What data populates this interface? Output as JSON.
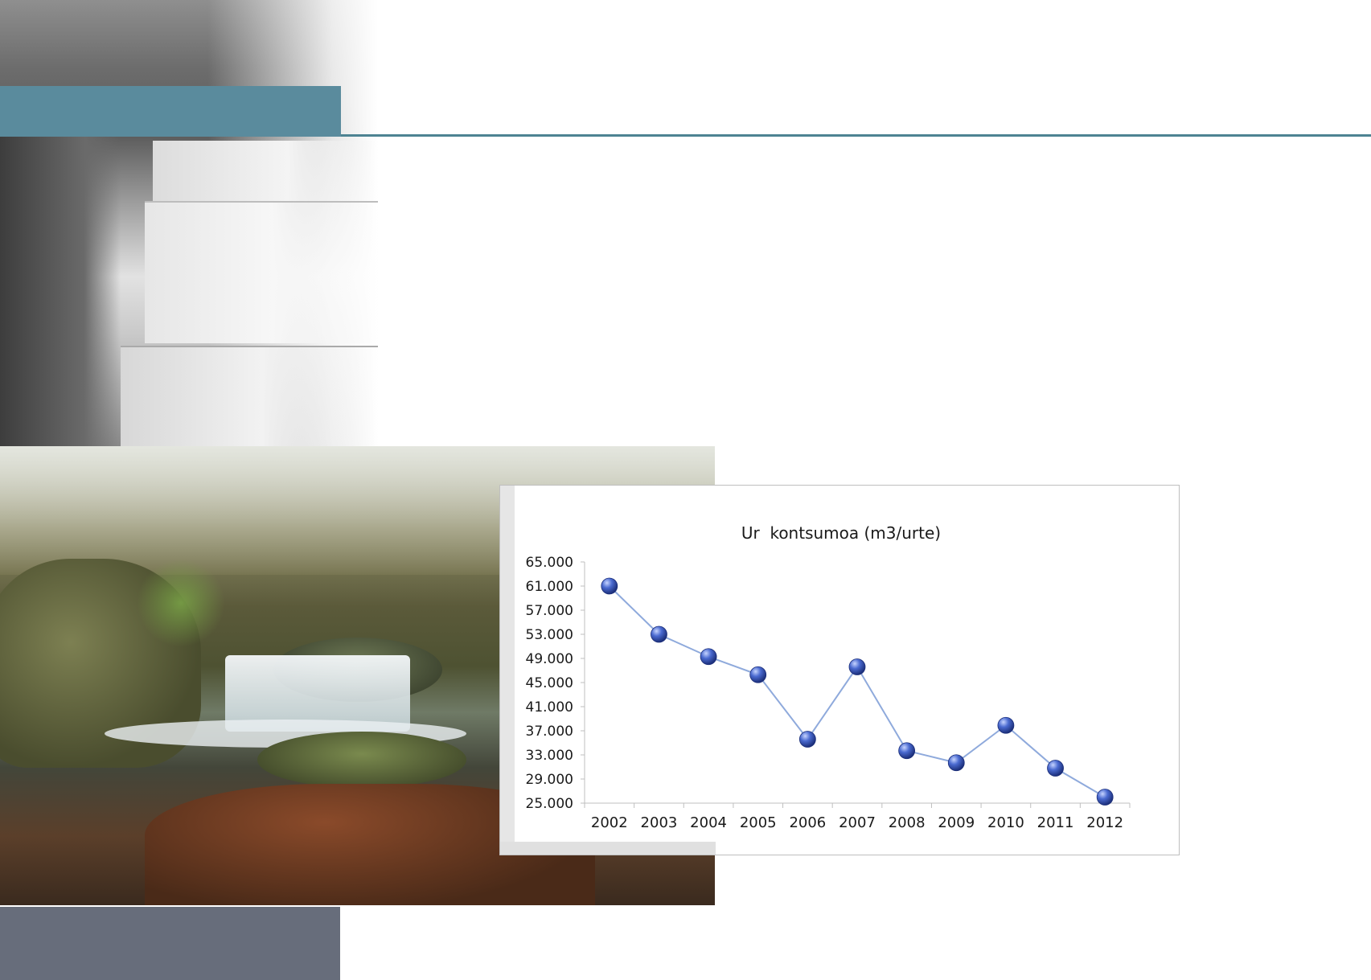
{
  "chart_data": {
    "type": "line",
    "title": "Ur  kontsumoa (m3/urte)",
    "xlabel": "",
    "ylabel": "",
    "categories": [
      "2002",
      "2003",
      "2004",
      "2005",
      "2006",
      "2007",
      "2008",
      "2009",
      "2010",
      "2011",
      "2012"
    ],
    "values": [
      61000,
      53000,
      49300,
      46300,
      35600,
      47600,
      33700,
      31700,
      37900,
      30800,
      26000
    ],
    "ylim": [
      25000,
      65000
    ],
    "yticks": [
      "25.000",
      "29.000",
      "33.000",
      "37.000",
      "41.000",
      "45.000",
      "49.000",
      "53.000",
      "57.000",
      "61.000",
      "65.000"
    ],
    "ytick_values": [
      25000,
      29000,
      33000,
      37000,
      41000,
      45000,
      49000,
      53000,
      57000,
      61000,
      65000
    ],
    "grid": false,
    "legend": "none",
    "line_color": "#8faadc",
    "marker_color": "#2f4fb0"
  },
  "colors": {
    "teal_block": "#5a8b9d",
    "slate_block": "#676d7b"
  }
}
